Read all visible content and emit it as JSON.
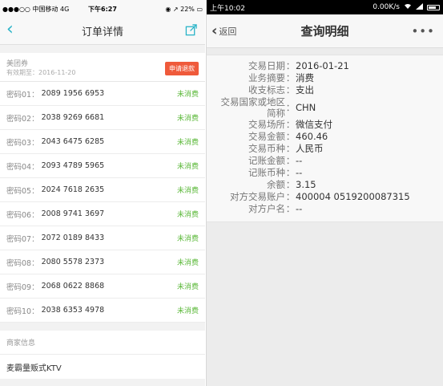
{
  "left": {
    "status": {
      "carrier": "●●●○○ 中国移动 4G",
      "time": "下午6:27",
      "battery": "◉ ↗ 22% ▭"
    },
    "nav": {
      "title": "订单详情"
    },
    "coupon": {
      "name": "美团券",
      "valid": "有效期至：2016-11-20",
      "refund_label": "申请退款"
    },
    "codes": [
      {
        "label": "密码01：",
        "value": "2089 1956 6953",
        "status": "未消费"
      },
      {
        "label": "密码02：",
        "value": "2038 9269 6681",
        "status": "未消费"
      },
      {
        "label": "密码03：",
        "value": "2043 6475 6285",
        "status": "未消费"
      },
      {
        "label": "密码04：",
        "value": "2093 4789 5965",
        "status": "未消费"
      },
      {
        "label": "密码05：",
        "value": "2024 7618 2635",
        "status": "未消费"
      },
      {
        "label": "密码06：",
        "value": "2008 9741 3697",
        "status": "未消费"
      },
      {
        "label": "密码07：",
        "value": "2072 0189 8433",
        "status": "未消费"
      },
      {
        "label": "密码08：",
        "value": "2080 5578 2373",
        "status": "未消费"
      },
      {
        "label": "密码09：",
        "value": "2068 0622 8868",
        "status": "未消费"
      },
      {
        "label": "密码10：",
        "value": "2038 6353 4978",
        "status": "未消费"
      }
    ],
    "merchant_header": "商家信息",
    "merchant_name": "麦霸量贩式KTV"
  },
  "right": {
    "status": {
      "time": "上午10:02",
      "speed": "0.00K/s"
    },
    "nav": {
      "back_label": "返回",
      "title": "查询明细",
      "more": "•••"
    },
    "rows": [
      {
        "k": "交易日期",
        "v": "2016-01-21"
      },
      {
        "k": "业务摘要",
        "v": "消费"
      },
      {
        "k": "收支标志",
        "v": "支出"
      },
      {
        "k1": "交易国家或地区",
        "k2": "简称",
        "v": "CHN"
      },
      {
        "k": "交易场所",
        "v": "微信支付"
      },
      {
        "k": "交易金额",
        "v": "460.46"
      },
      {
        "k": "交易币种",
        "v": "人民币"
      },
      {
        "k": "记账金额",
        "v": "--"
      },
      {
        "k": "记账币种",
        "v": "--"
      },
      {
        "k": "余额",
        "v": "3.15"
      },
      {
        "k": "对方交易账户",
        "v": "400004 0519200087315"
      },
      {
        "k": "对方户名",
        "v": "--"
      }
    ],
    "separator": "："
  },
  "colors": {
    "accent_teal": "#2bb4c8",
    "refund_red": "#ef5a3b",
    "unused_green": "#5bb839"
  }
}
